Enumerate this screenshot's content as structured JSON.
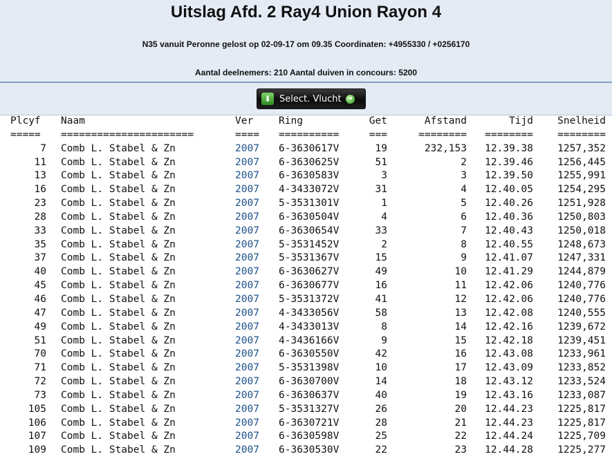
{
  "header": {
    "title": "Uitslag Afd. 2 Ray4 Union Rayon 4",
    "flight_info": "N35 vanuit Peronne gelost op 02-09-17 om 09.35 Coordinaten: +4955330 / +0256170",
    "participants": "Aantal deelnemers: 210 Aantal duiven in concours: 5200",
    "select_button_label": "Select. Vlucht"
  },
  "table": {
    "columns": [
      "Plcyf",
      "Naam",
      "Ver",
      "Ring",
      "Get",
      "Afstand",
      "Tijd",
      "Snelheid"
    ],
    "separators": [
      "=====",
      "======================",
      "====",
      "==========",
      "===",
      "========",
      "========",
      "========"
    ],
    "rows": [
      [
        "7",
        "Comb L. Stabel & Zn",
        "2007",
        "6-3630617V",
        "19",
        "232,153",
        "12.39.38",
        "1257,352"
      ],
      [
        "11",
        "Comb L. Stabel & Zn",
        "2007",
        "6-3630625V",
        "51",
        "2",
        "12.39.46",
        "1256,445"
      ],
      [
        "13",
        "Comb L. Stabel & Zn",
        "2007",
        "6-3630583V",
        "3",
        "3",
        "12.39.50",
        "1255,991"
      ],
      [
        "16",
        "Comb L. Stabel & Zn",
        "2007",
        "4-3433072V",
        "31",
        "4",
        "12.40.05",
        "1254,295"
      ],
      [
        "23",
        "Comb L. Stabel & Zn",
        "2007",
        "5-3531301V",
        "1",
        "5",
        "12.40.26",
        "1251,928"
      ],
      [
        "28",
        "Comb L. Stabel & Zn",
        "2007",
        "6-3630504V",
        "4",
        "6",
        "12.40.36",
        "1250,803"
      ],
      [
        "33",
        "Comb L. Stabel & Zn",
        "2007",
        "6-3630654V",
        "33",
        "7",
        "12.40.43",
        "1250,018"
      ],
      [
        "35",
        "Comb L. Stabel & Zn",
        "2007",
        "5-3531452V",
        "2",
        "8",
        "12.40.55",
        "1248,673"
      ],
      [
        "37",
        "Comb L. Stabel & Zn",
        "2007",
        "5-3531367V",
        "15",
        "9",
        "12.41.07",
        "1247,331"
      ],
      [
        "40",
        "Comb L. Stabel & Zn",
        "2007",
        "6-3630627V",
        "49",
        "10",
        "12.41.29",
        "1244,879"
      ],
      [
        "45",
        "Comb L. Stabel & Zn",
        "2007",
        "6-3630677V",
        "16",
        "11",
        "12.42.06",
        "1240,776"
      ],
      [
        "46",
        "Comb L. Stabel & Zn",
        "2007",
        "5-3531372V",
        "41",
        "12",
        "12.42.06",
        "1240,776"
      ],
      [
        "47",
        "Comb L. Stabel & Zn",
        "2007",
        "4-3433056V",
        "58",
        "13",
        "12.42.08",
        "1240,555"
      ],
      [
        "49",
        "Comb L. Stabel & Zn",
        "2007",
        "4-3433013V",
        "8",
        "14",
        "12.42.16",
        "1239,672"
      ],
      [
        "51",
        "Comb L. Stabel & Zn",
        "2007",
        "4-3436166V",
        "9",
        "15",
        "12.42.18",
        "1239,451"
      ],
      [
        "70",
        "Comb L. Stabel & Zn",
        "2007",
        "6-3630550V",
        "42",
        "16",
        "12.43.08",
        "1233,961"
      ],
      [
        "71",
        "Comb L. Stabel & Zn",
        "2007",
        "5-3531398V",
        "10",
        "17",
        "12.43.09",
        "1233,852"
      ],
      [
        "72",
        "Comb L. Stabel & Zn",
        "2007",
        "6-3630700V",
        "14",
        "18",
        "12.43.12",
        "1233,524"
      ],
      [
        "73",
        "Comb L. Stabel & Zn",
        "2007",
        "6-3630637V",
        "40",
        "19",
        "12.43.16",
        "1233,087"
      ],
      [
        "105",
        "Comb L. Stabel & Zn",
        "2007",
        "5-3531327V",
        "26",
        "20",
        "12.44.23",
        "1225,817"
      ],
      [
        "106",
        "Comb L. Stabel & Zn",
        "2007",
        "6-3630721V",
        "28",
        "21",
        "12.44.23",
        "1225,817"
      ],
      [
        "107",
        "Comb L. Stabel & Zn",
        "2007",
        "6-3630598V",
        "25",
        "22",
        "12.44.24",
        "1225,709"
      ],
      [
        "109",
        "Comb L. Stabel & Zn",
        "2007",
        "6-3630530V",
        "22",
        "23",
        "12.44.28",
        "1225,277"
      ]
    ]
  },
  "colors": {
    "header_bg": "#e4ebf5",
    "divider": "#7f9cc3",
    "link": "#1d4f8a"
  },
  "icons": {
    "button_left": "download-icon",
    "button_right": "arrow-right-icon"
  }
}
